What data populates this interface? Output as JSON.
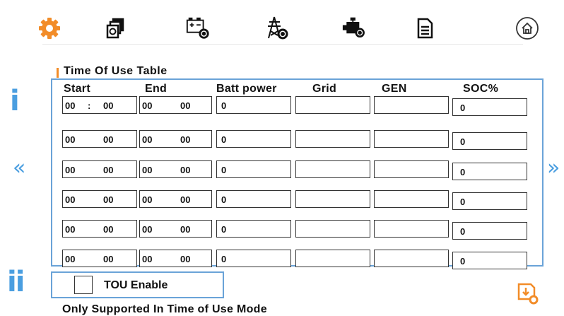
{
  "toolbar": {
    "icons": [
      "gear-icon",
      "copy-pages-icon",
      "battery-gear-icon",
      "grid-tower-gear-icon",
      "generator-gear-icon",
      "document-icon",
      "home-icon"
    ],
    "accent": "#f28c28"
  },
  "section": {
    "title": "Time Of Use Table"
  },
  "table": {
    "headers": {
      "start": "Start",
      "end": "End",
      "batt_power": "Batt power",
      "grid": "Grid",
      "gen": "GEN",
      "soc": "SOC%"
    },
    "rows": [
      {
        "start_h": "00",
        "start_sep": ":",
        "start_m": "00",
        "end_h": "00",
        "end_m": "00",
        "batt": "0",
        "grid": "",
        "gen": "",
        "soc": "0"
      },
      {
        "start_h": "00",
        "start_sep": "",
        "start_m": "00",
        "end_h": "00",
        "end_m": "00",
        "batt": "0",
        "grid": "",
        "gen": "",
        "soc": "0"
      },
      {
        "start_h": "00",
        "start_sep": "",
        "start_m": "00",
        "end_h": "00",
        "end_m": "00",
        "batt": "0",
        "grid": "",
        "gen": "",
        "soc": "0"
      },
      {
        "start_h": "00",
        "start_sep": "",
        "start_m": "00",
        "end_h": "00",
        "end_m": "00",
        "batt": "0",
        "grid": "",
        "gen": "",
        "soc": "0"
      },
      {
        "start_h": "00",
        "start_sep": "",
        "start_m": "00",
        "end_h": "00",
        "end_m": "00",
        "batt": "0",
        "grid": "",
        "gen": "",
        "soc": "0"
      },
      {
        "start_h": "00",
        "start_sep": "",
        "start_m": "00",
        "end_h": "00",
        "end_m": "00",
        "batt": "0",
        "grid": "",
        "gen": "",
        "soc": "0"
      }
    ]
  },
  "markers": {
    "i": "i",
    "ii": "ii"
  },
  "nav": {
    "prev": "«",
    "next": "»"
  },
  "tou": {
    "label": "TOU Enable",
    "checked": false,
    "note": "Only Supported In Time of Use Mode"
  },
  "colors": {
    "frame": "#6aa3d8",
    "marker": "#4a9ee0"
  }
}
